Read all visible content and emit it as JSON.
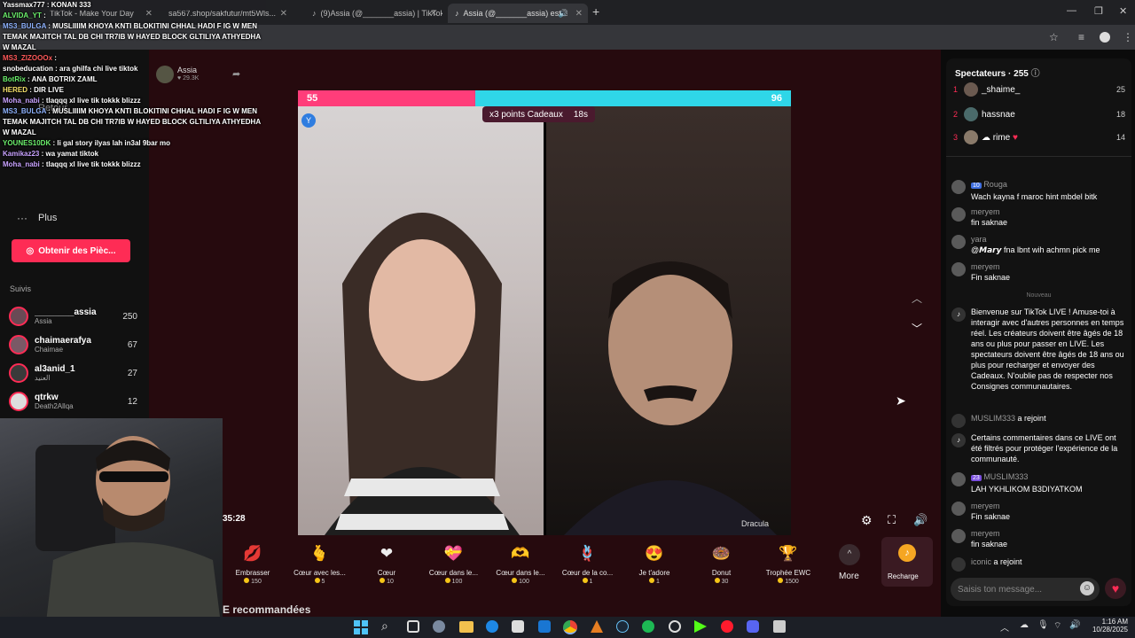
{
  "browser": {
    "tabs": [
      {
        "title": "Yassmax777 : KONAN 333"
      },
      {
        "title": "TikTok - Make Your Day"
      },
      {
        "title": "sa567.shop/sakfutur/mt5Wls..."
      },
      {
        "title": "(9)Assia (@_______assia) | TikTok"
      },
      {
        "title": "Assia (@_______assia) est..."
      }
    ]
  },
  "overlay_chat": [
    {
      "user": "Yassmax777",
      "msg": "KONAN 333",
      "color": "#ffffff"
    },
    {
      "user": "ALVIDA_YT",
      "msg": "",
      "color": "#6cf06c"
    },
    {
      "user": "MS3_BULGA",
      "msg": "MUSLIIIIM KHOYA KNTI BLOKITINI CHHAL HADI F IG W MEN TEMAK MAJITCH TAL DB CHI TR7IB W HAYED BLOCK GLTILIYA ATHYEDHA W MAZAL",
      "color": "#8fb3ff"
    },
    {
      "user": "MS3_ZIZOOOx",
      "msg": "",
      "color": "#ff5a5a"
    },
    {
      "user": "snobeducation",
      "msg": "ara ghilfa chi live tiktok",
      "color": "#ffffff"
    },
    {
      "user": "BotRix",
      "msg": "ANA BOTRIX ZAML",
      "color": "#6cf06c"
    },
    {
      "user": "HERED",
      "msg": "DIR LIVE",
      "color": "#f5e26b"
    },
    {
      "user": "Moha_nabi",
      "msg": "tlaqqq xl live tik tokkk blizzz",
      "color": "#c9a3ff"
    },
    {
      "user": "MS3_BULGA",
      "msg": "MUSLIIIIM KHOYA KNTI BLOKITINI CHHAL HADI F IG W MEN TEMAK MAJITCH TAL DB CHI TR7IB W HAYED BLOCK GLTILIYA ATHYEDHA W MAZAL",
      "color": "#8fb3ff"
    },
    {
      "user": "YOUNES10DK",
      "msg": "li gal story ilyas lah in3al 9bar mo",
      "color": "#6cf06c"
    },
    {
      "user": "Kamikaz23",
      "msg": "wa yamat tiktok",
      "color": "#c9a3ff"
    },
    {
      "user": "Moha_nabi",
      "msg": "tlaqqq xl live tik tokkk blizzz",
      "color": "#c9a3ff"
    }
  ],
  "sidebar": {
    "live_host": {
      "name": "Assia",
      "likes": "29.3K"
    },
    "back_label": "Retour",
    "more_label": "Plus",
    "coins_button": "Obtenir des Pièc...",
    "following_title": "Suivis",
    "following": [
      {
        "name": "________assia",
        "sub": "Assia",
        "count": "250"
      },
      {
        "name": "chaimaerafya",
        "sub": "Chaimae",
        "count": "67"
      },
      {
        "name": "al3anid_1",
        "sub": "العنيد",
        "count": "27"
      },
      {
        "name": "qtrkw",
        "sub": "Death2Allqa",
        "count": "12"
      }
    ]
  },
  "stream": {
    "battle": {
      "left_score": "55",
      "right_score": "96",
      "left_fraction": 0.36,
      "multiplier_label": "x3 points Cadeaux",
      "timer": "18s"
    },
    "left_badge": "Y",
    "opponent_name": "Dracula",
    "webcam_timer": "35:28"
  },
  "gifts": [
    {
      "name": "Embrasser",
      "price": "150",
      "icon": "lips-icon",
      "glyph": "💋"
    },
    {
      "name": "Cœur avec les...",
      "price": "5",
      "icon": "finger-heart-icon",
      "glyph": "🫰"
    },
    {
      "name": "Cœur",
      "price": "10",
      "icon": "heart-icon",
      "glyph": "❤"
    },
    {
      "name": "Cœur dans le...",
      "price": "100",
      "icon": "heart-box-icon",
      "glyph": "💝"
    },
    {
      "name": "Cœur dans le...",
      "price": "100",
      "icon": "heart-hands-icon",
      "glyph": "🫶"
    },
    {
      "name": "Cœur de la co...",
      "price": "1",
      "icon": "knot-heart-icon",
      "glyph": "🪢"
    },
    {
      "name": "Je t'adore",
      "price": "1",
      "icon": "adore-icon",
      "glyph": "😍"
    },
    {
      "name": "Donut",
      "price": "30",
      "icon": "donut-icon",
      "glyph": "🍩"
    },
    {
      "name": "Trophée EWC",
      "price": "1500",
      "icon": "trophy-icon",
      "glyph": "🏆"
    }
  ],
  "more_label": "More",
  "recharge_label": "Recharge",
  "recommended_label": "E recommandées",
  "right_panel": {
    "viewers_title": "Spectateurs · 255",
    "top_viewers": [
      {
        "rank": "1",
        "name": "_shaime_",
        "score": "25"
      },
      {
        "rank": "2",
        "name": "hassnae",
        "score": "18"
      },
      {
        "rank": "3",
        "name": "rime",
        "score": "14"
      }
    ],
    "comments": [
      {
        "user": "Rouga",
        "badge": "10",
        "text": "Wach kayna f maroc hint mbdel bitk"
      },
      {
        "user": "meryem",
        "badge": "",
        "text": "fin saknae"
      },
      {
        "user": "yara",
        "badge": "",
        "text": "@𝙈𝙖𝙧𝙮 fna lbnt wih achmn pick me"
      },
      {
        "user": "meryem",
        "badge": "",
        "text": "Fin saknae"
      }
    ],
    "new_label": "Nouveau",
    "system_msg": "Bienvenue sur TikTok LIVE ! Amuse-toi à interagir avec d'autres personnes en temps réel. Les créateurs doivent être âgés de 18 ans ou plus pour passer en LIVE. Les spectateurs doivent être âgés de 18 ans ou plus pour recharger et envoyer des Cadeaux. N'oublie pas de respecter nos Consignes communautaires.",
    "joined1": {
      "user": "MUSLIM333",
      "text": "a rejoint"
    },
    "filtered_msg": "Certains commentaires dans ce LIVE ont été filtrés pour protéger l'expérience de la communauté.",
    "comment2": {
      "user": "MUSLIM333",
      "badge": "23",
      "text": "LAH YKHLIKOM B3DIYATKOM"
    },
    "comment3": {
      "user": "meryem",
      "text": "Fin saknae"
    },
    "comment4": {
      "user": "meryem",
      "text": "fin saknae"
    },
    "joined2": {
      "user": "iconic",
      "text": "a rejoint"
    },
    "input_placeholder": "Saisis ton message..."
  },
  "taskbar": {
    "time": "1:16 AM",
    "date": "10/28/2025"
  }
}
